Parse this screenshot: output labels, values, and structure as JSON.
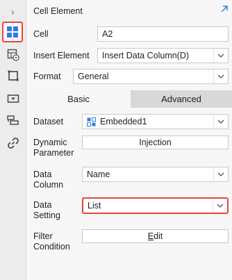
{
  "header": {
    "title": "Cell Element"
  },
  "sidebar": {
    "items": [
      {
        "icon": "expand-arrow-icon"
      },
      {
        "icon": "cell-element-icon",
        "selected": true
      },
      {
        "icon": "cell-attribute-icon"
      },
      {
        "icon": "widget-icon"
      },
      {
        "icon": "hyperlink-icon"
      },
      {
        "icon": "filter-icon"
      },
      {
        "icon": "link-icon"
      }
    ]
  },
  "form": {
    "cell_label": "Cell",
    "cell_value": "A2",
    "insert_label": "Insert Element",
    "insert_value": "Insert Data Column(D)",
    "format_label": "Format",
    "format_value": "General"
  },
  "tabs": {
    "basic": "Basic",
    "advanced": "Advanced",
    "active": "Basic"
  },
  "basic": {
    "dataset_label": "Dataset",
    "dataset_value": "Embedded1",
    "dynamic_param_label_1": "Dynamic",
    "dynamic_param_label_2": "Parameter",
    "injection_button": "Injection",
    "data_column_label_1": "Data",
    "data_column_label_2": "Column",
    "data_column_value": "Name",
    "data_setting_label_1": "Data",
    "data_setting_label_2": "Setting",
    "data_setting_value": "List",
    "filter_label_1": "Filter",
    "filter_label_2": "Condition",
    "edit_button_mnemonic": "E",
    "edit_button_rest": "dit"
  },
  "colors": {
    "highlight": "#e8443a",
    "icon_blue": "#2f7de1",
    "panel_bg": "#f7f7f7"
  }
}
